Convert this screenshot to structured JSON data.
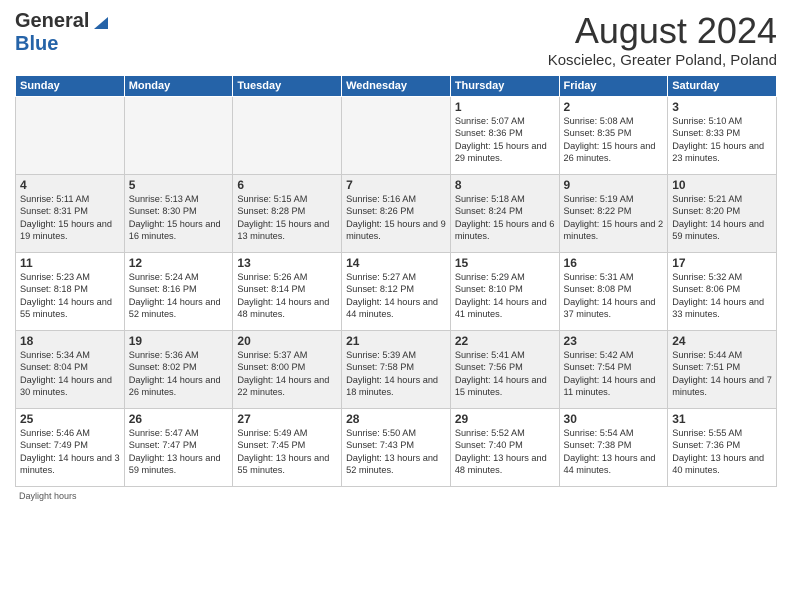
{
  "header": {
    "logo_general": "General",
    "logo_blue": "Blue",
    "month_year": "August 2024",
    "location": "Koscielec, Greater Poland, Poland"
  },
  "days_of_week": [
    "Sunday",
    "Monday",
    "Tuesday",
    "Wednesday",
    "Thursday",
    "Friday",
    "Saturday"
  ],
  "weeks": [
    [
      {
        "day": "",
        "empty": true
      },
      {
        "day": "",
        "empty": true
      },
      {
        "day": "",
        "empty": true
      },
      {
        "day": "",
        "empty": true
      },
      {
        "day": "1",
        "sunrise": "5:07 AM",
        "sunset": "8:36 PM",
        "daylight": "15 hours and 29 minutes."
      },
      {
        "day": "2",
        "sunrise": "5:08 AM",
        "sunset": "8:35 PM",
        "daylight": "15 hours and 26 minutes."
      },
      {
        "day": "3",
        "sunrise": "5:10 AM",
        "sunset": "8:33 PM",
        "daylight": "15 hours and 23 minutes."
      }
    ],
    [
      {
        "day": "4",
        "sunrise": "5:11 AM",
        "sunset": "8:31 PM",
        "daylight": "15 hours and 19 minutes."
      },
      {
        "day": "5",
        "sunrise": "5:13 AM",
        "sunset": "8:30 PM",
        "daylight": "15 hours and 16 minutes."
      },
      {
        "day": "6",
        "sunrise": "5:15 AM",
        "sunset": "8:28 PM",
        "daylight": "15 hours and 13 minutes."
      },
      {
        "day": "7",
        "sunrise": "5:16 AM",
        "sunset": "8:26 PM",
        "daylight": "15 hours and 9 minutes."
      },
      {
        "day": "8",
        "sunrise": "5:18 AM",
        "sunset": "8:24 PM",
        "daylight": "15 hours and 6 minutes."
      },
      {
        "day": "9",
        "sunrise": "5:19 AM",
        "sunset": "8:22 PM",
        "daylight": "15 hours and 2 minutes."
      },
      {
        "day": "10",
        "sunrise": "5:21 AM",
        "sunset": "8:20 PM",
        "daylight": "14 hours and 59 minutes."
      }
    ],
    [
      {
        "day": "11",
        "sunrise": "5:23 AM",
        "sunset": "8:18 PM",
        "daylight": "14 hours and 55 minutes."
      },
      {
        "day": "12",
        "sunrise": "5:24 AM",
        "sunset": "8:16 PM",
        "daylight": "14 hours and 52 minutes."
      },
      {
        "day": "13",
        "sunrise": "5:26 AM",
        "sunset": "8:14 PM",
        "daylight": "14 hours and 48 minutes."
      },
      {
        "day": "14",
        "sunrise": "5:27 AM",
        "sunset": "8:12 PM",
        "daylight": "14 hours and 44 minutes."
      },
      {
        "day": "15",
        "sunrise": "5:29 AM",
        "sunset": "8:10 PM",
        "daylight": "14 hours and 41 minutes."
      },
      {
        "day": "16",
        "sunrise": "5:31 AM",
        "sunset": "8:08 PM",
        "daylight": "14 hours and 37 minutes."
      },
      {
        "day": "17",
        "sunrise": "5:32 AM",
        "sunset": "8:06 PM",
        "daylight": "14 hours and 33 minutes."
      }
    ],
    [
      {
        "day": "18",
        "sunrise": "5:34 AM",
        "sunset": "8:04 PM",
        "daylight": "14 hours and 30 minutes."
      },
      {
        "day": "19",
        "sunrise": "5:36 AM",
        "sunset": "8:02 PM",
        "daylight": "14 hours and 26 minutes."
      },
      {
        "day": "20",
        "sunrise": "5:37 AM",
        "sunset": "8:00 PM",
        "daylight": "14 hours and 22 minutes."
      },
      {
        "day": "21",
        "sunrise": "5:39 AM",
        "sunset": "7:58 PM",
        "daylight": "14 hours and 18 minutes."
      },
      {
        "day": "22",
        "sunrise": "5:41 AM",
        "sunset": "7:56 PM",
        "daylight": "14 hours and 15 minutes."
      },
      {
        "day": "23",
        "sunrise": "5:42 AM",
        "sunset": "7:54 PM",
        "daylight": "14 hours and 11 minutes."
      },
      {
        "day": "24",
        "sunrise": "5:44 AM",
        "sunset": "7:51 PM",
        "daylight": "14 hours and 7 minutes."
      }
    ],
    [
      {
        "day": "25",
        "sunrise": "5:46 AM",
        "sunset": "7:49 PM",
        "daylight": "14 hours and 3 minutes."
      },
      {
        "day": "26",
        "sunrise": "5:47 AM",
        "sunset": "7:47 PM",
        "daylight": "13 hours and 59 minutes."
      },
      {
        "day": "27",
        "sunrise": "5:49 AM",
        "sunset": "7:45 PM",
        "daylight": "13 hours and 55 minutes."
      },
      {
        "day": "28",
        "sunrise": "5:50 AM",
        "sunset": "7:43 PM",
        "daylight": "13 hours and 52 minutes."
      },
      {
        "day": "29",
        "sunrise": "5:52 AM",
        "sunset": "7:40 PM",
        "daylight": "13 hours and 48 minutes."
      },
      {
        "day": "30",
        "sunrise": "5:54 AM",
        "sunset": "7:38 PM",
        "daylight": "13 hours and 44 minutes."
      },
      {
        "day": "31",
        "sunrise": "5:55 AM",
        "sunset": "7:36 PM",
        "daylight": "13 hours and 40 minutes."
      }
    ]
  ],
  "footer": {
    "daylight_label": "Daylight hours"
  }
}
